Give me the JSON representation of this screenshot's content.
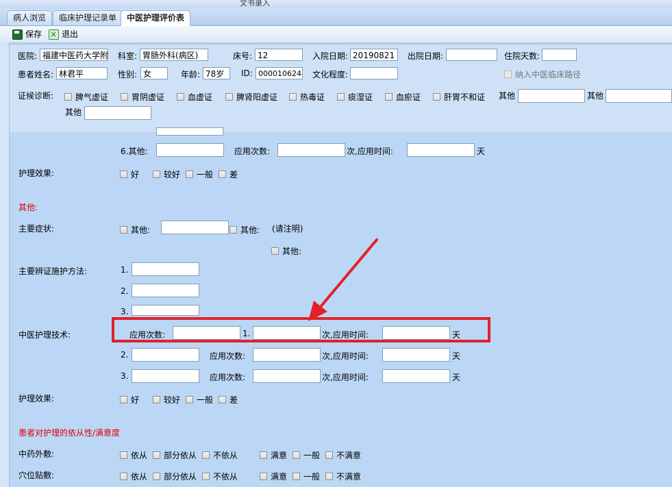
{
  "window": {
    "title": "文书录入"
  },
  "tabs": [
    {
      "label": "病人浏览",
      "active": false
    },
    {
      "label": "临床护理记录单",
      "active": false
    },
    {
      "label": "中医护理评价表",
      "active": true
    }
  ],
  "toolbar": {
    "save_label": "保存",
    "exit_label": "退出"
  },
  "patient": {
    "hospital_label": "医院:",
    "hospital_value": "福建中医药大学附",
    "dept_label": "科室:",
    "dept_value": "胃肠外科(病区)",
    "bed_label": "床号:",
    "bed_value": "12",
    "admit_label": "入院日期:",
    "admit_value": "20190821",
    "discharge_label": "出院日期:",
    "discharge_value": "",
    "stay_label": "住院天数:",
    "stay_value": "",
    "name_label": "患者姓名:",
    "name_value": "林君平",
    "sex_label": "性别:",
    "sex_value": "女",
    "age_label": "年龄:",
    "age_value": "78岁",
    "id_label": "ID:",
    "id_value": "0000106248",
    "edu_label": "文化程度:",
    "edu_value": "",
    "pathway_label": "纳入中医临床路径"
  },
  "syndrome": {
    "label": "证候诊断:",
    "options": [
      "脾气虚证",
      "胃阴虚证",
      "血虚证",
      "脾肾阳虚证",
      "热毒证",
      "痰湿证",
      "血瘀证",
      "肝胃不和证"
    ],
    "other1_label": "其他",
    "other2_label": "其他",
    "other3_label": "其他"
  },
  "form": {
    "item6_label": "6.其他:",
    "apply_count_label": "应用次数:",
    "times_time_label": "次,应用时间:",
    "day_unit": "天",
    "effect_label": "护理效果:",
    "effect_options": [
      "好",
      "较好",
      "一般",
      "差"
    ],
    "other_section_title": "其他:",
    "main_symptom_label": "主要症状:",
    "other_cb_label": "其他:",
    "note_label": "(请注明)",
    "method_label": "主要辨证施护方法:",
    "num1": "1.",
    "num2": "2.",
    "num3": "3.",
    "tcm_tech_label": "中医护理技术:",
    "compliance_title": "患者对护理的依从性/满意度",
    "herb_label": "中药外敷:",
    "acupoint_label": "穴位贴敷:",
    "comply_options": [
      "依从",
      "部分依从",
      "不依从"
    ],
    "satisfy_options": [
      "满意",
      "一般",
      "不满意"
    ]
  }
}
